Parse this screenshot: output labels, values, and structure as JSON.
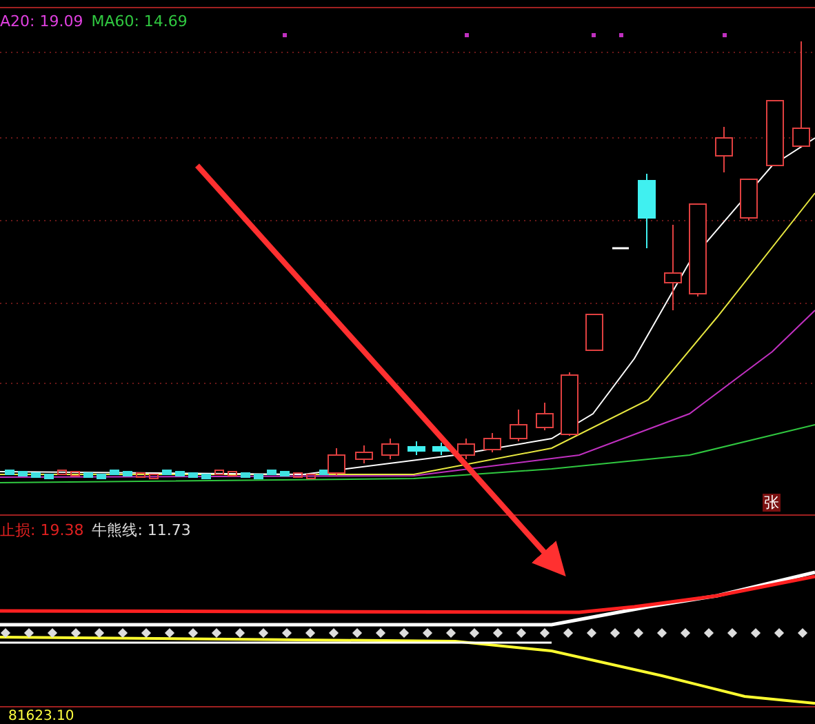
{
  "price_panel": {
    "legend": [
      {
        "label": "A20: 19.09",
        "color": "#e040e0"
      },
      {
        "label": "MA60: 14.69",
        "color": "#30c840"
      }
    ],
    "badge": "张"
  },
  "indicator_panel": {
    "legend": [
      {
        "label": "止损: 19.38",
        "color": "#e02020"
      },
      {
        "label": "牛熊线: 11.73",
        "color": "#dddddd"
      }
    ]
  },
  "footer": {
    "value": "81623.10"
  }
}
